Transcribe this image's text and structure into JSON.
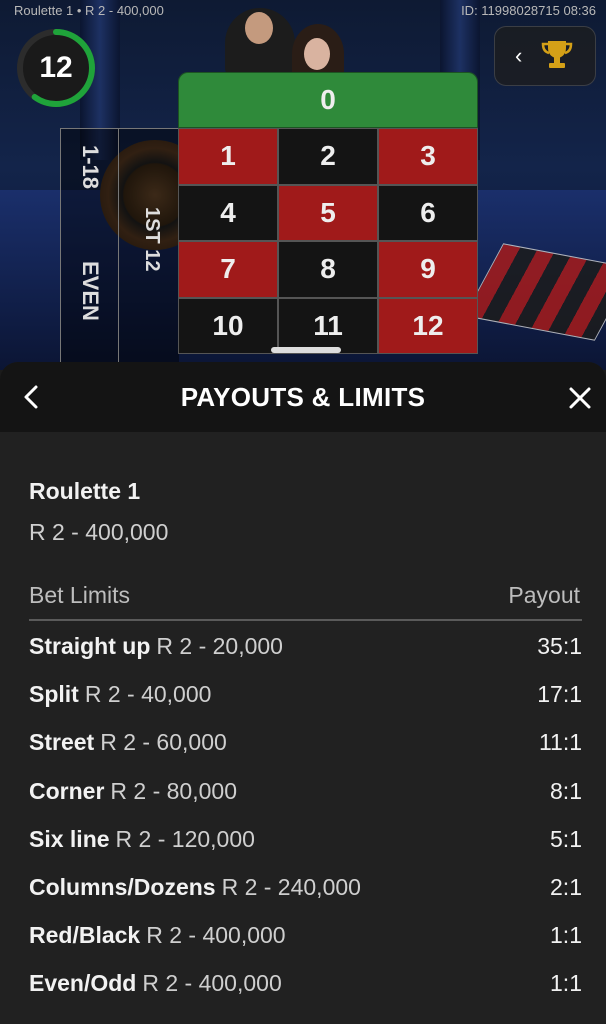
{
  "topbar": {
    "game_title": "Roulette 1 • R 2 - 400,000",
    "game_id": "ID: 11998028715 08:36"
  },
  "timer": {
    "seconds": "12",
    "remaining_fraction": 0.6
  },
  "board": {
    "zero": "0",
    "numbers": [
      {
        "n": "1",
        "color": "red"
      },
      {
        "n": "2",
        "color": "black"
      },
      {
        "n": "3",
        "color": "red"
      },
      {
        "n": "4",
        "color": "black"
      },
      {
        "n": "5",
        "color": "red"
      },
      {
        "n": "6",
        "color": "black"
      },
      {
        "n": "7",
        "color": "red"
      },
      {
        "n": "8",
        "color": "black"
      },
      {
        "n": "9",
        "color": "red"
      },
      {
        "n": "10",
        "color": "black"
      },
      {
        "n": "11",
        "color": "black"
      },
      {
        "n": "12",
        "color": "red"
      }
    ],
    "outside_low": "1-18",
    "outside_even": "EVEN",
    "dozen": "1ST 12"
  },
  "panel": {
    "title": "PAYOUTS & LIMITS",
    "table_name": "Roulette 1",
    "table_range": "R 2 - 400,000",
    "col_limits": "Bet Limits",
    "col_payout": "Payout",
    "rows": [
      {
        "name": "Straight up",
        "limit": "R 2 - 20,000",
        "payout": "35:1"
      },
      {
        "name": "Split",
        "limit": "R 2 - 40,000",
        "payout": "17:1"
      },
      {
        "name": "Street",
        "limit": "R 2 - 60,000",
        "payout": "11:1"
      },
      {
        "name": "Corner",
        "limit": "R 2 - 80,000",
        "payout": "8:1"
      },
      {
        "name": "Six line",
        "limit": "R 2 - 120,000",
        "payout": "5:1"
      },
      {
        "name": "Columns/Dozens",
        "limit": "R 2 - 240,000",
        "payout": "2:1"
      },
      {
        "name": "Red/Black",
        "limit": "R 2 - 400,000",
        "payout": "1:1"
      },
      {
        "name": "Even/Odd",
        "limit": "R 2 - 400,000",
        "payout": "1:1"
      }
    ]
  },
  "colors": {
    "red": "#a01a1a",
    "black": "#141414",
    "green": "#2f8a3a",
    "timer_ring": "#1fa33a",
    "trophy": "#d4a017"
  },
  "icons": [
    "back-icon",
    "close-icon",
    "trophy-icon",
    "chevron-left-icon"
  ]
}
